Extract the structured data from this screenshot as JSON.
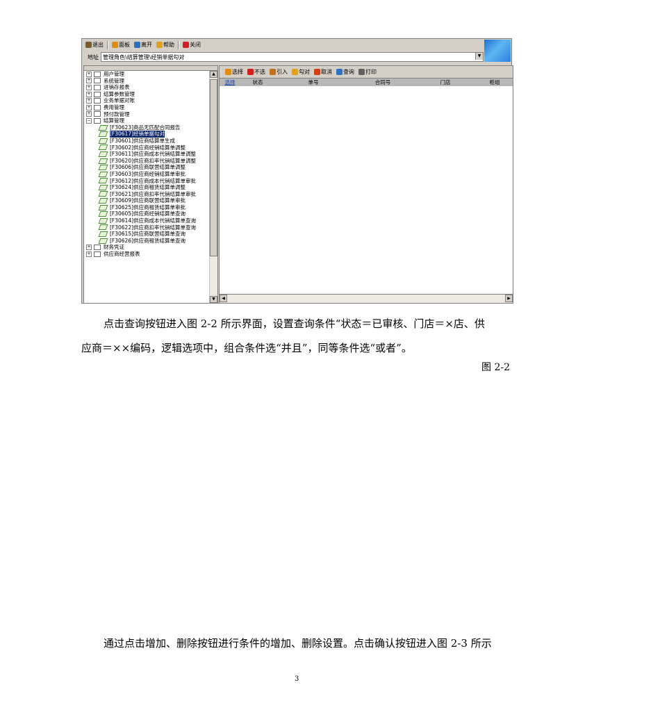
{
  "screenshot": {
    "toolbar": [
      {
        "label": "退出",
        "icon": "exit-icon",
        "color": "#7a5c2e"
      },
      {
        "label": "面板",
        "icon": "panel-icon",
        "color": "#e08a10"
      },
      {
        "label": "离开",
        "icon": "leave-icon",
        "color": "#2e6fbf"
      },
      {
        "label": "帮助",
        "icon": "help-icon",
        "color": "#e0a020"
      },
      {
        "label": "关闭",
        "icon": "close-icon",
        "color": "#d02020"
      }
    ],
    "address": {
      "label": "地址",
      "value": "管理角色\\结算管理\\经销单据勾对"
    },
    "tree": {
      "groups_before": [
        "用户管理",
        "系统管理",
        "进销存报表",
        "结算参数管理",
        "业务单据对账",
        "费用管理",
        "预付款管理"
      ],
      "open_group": "结算管理",
      "leaves": [
        "[F30623]商品无匹配合同报告",
        "[F30617]经销单据勾对",
        "[F30601]供应商结算单生成",
        "[F30602]供应商经销结算单调整",
        "[F30611]供应商成本代销结算单调整",
        "[F30620]供应商扣率代销结算单调整",
        "[F30606]供应商联营结算单调整",
        "[F30603]供应商经销结算单审批",
        "[F30612]供应商成本代销结算单审批",
        "[F30624]供应商租赁结算单调整",
        "[F30621]供应商扣率代销结算单审批",
        "[F30609]供应商联营结算单审批",
        "[F30625]供应商租赁结算单审批",
        "[F30605]供应商经销结算单查询",
        "[F30614]供应商成本代销结算单查询",
        "[F30622]供应商扣率代销结算单查询",
        "[F30615]供应商联营结算单查询",
        "[F30626]供应商租赁结算单查询"
      ],
      "selected_leaf": 1,
      "groups_after": [
        "财务凭证",
        "供应商经营报表"
      ]
    },
    "right_toolbar": [
      {
        "label": "选择",
        "icon": "select-icon",
        "color": "#e08a10"
      },
      {
        "label": "不选",
        "icon": "deselect-icon",
        "color": "#d02020"
      },
      {
        "label": "引入",
        "icon": "import-icon",
        "color": "#c07020"
      },
      {
        "label": "勾对",
        "icon": "check-icon",
        "color": "#e0a020"
      },
      {
        "label": "取消",
        "icon": "cancel-icon",
        "color": "#d04010"
      },
      {
        "label": "查询",
        "icon": "query-icon",
        "color": "#3070c0"
      },
      {
        "label": "打印",
        "icon": "print-icon",
        "color": "#606060"
      }
    ],
    "columns": [
      "选择",
      "状态",
      "单号",
      "合同号",
      "门店",
      "柜组"
    ]
  },
  "text": {
    "para1_line1": "点击查询按钮进入图 2-2 所示界面，设置查询条件“状态＝已审核、门店＝×店、供",
    "para1_line2": "应商＝××编码，逻辑选项中，组合条件选“并且”，同等条件选“或者”。",
    "caption": "图 2-2",
    "para2": "通过点击增加、删除按钮进行条件的增加、删除设置。点击确认按钮进入图 2-3 所示",
    "page_number": "3"
  }
}
